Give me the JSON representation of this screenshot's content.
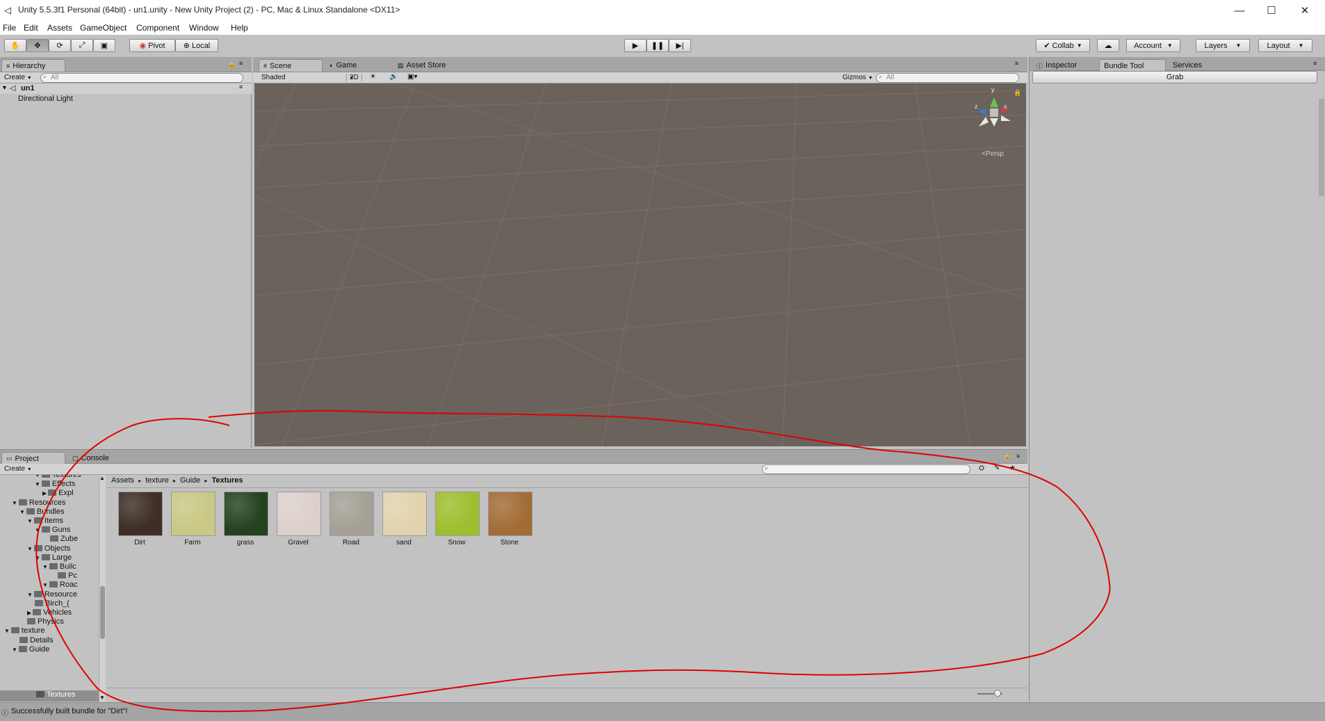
{
  "window": {
    "title": "Unity 5.5.3f1 Personal (64bit) - un1.unity - New Unity Project (2) - PC, Mac & Linux Standalone <DX11>",
    "controls": [
      "—",
      "☐",
      "✕"
    ]
  },
  "menu": [
    "File",
    "Edit",
    "Assets",
    "GameObject",
    "Component",
    "Window",
    "Help"
  ],
  "toolbar": {
    "pivot_label": "Pivot",
    "local_label": "Local",
    "collab_label": "Collab",
    "account_label": "Account",
    "layers_label": "Layers",
    "layout_label": "Layout"
  },
  "hierarchy": {
    "tab": "Hierarchy",
    "create_label": "Create",
    "search_placeholder": "All",
    "scene_name": "un1",
    "items": [
      "Directional Light"
    ]
  },
  "scene": {
    "tabs": [
      "Scene",
      "Game",
      "Asset Store"
    ],
    "shading": "Shaded",
    "mode_2d": "2D",
    "gizmos_label": "Gizmos",
    "search_placeholder": "All",
    "persp_label": "Persp",
    "axis_labels": {
      "y": "y",
      "z": "z",
      "x": "x"
    }
  },
  "inspector": {
    "tabs": [
      "Inspector",
      "Bundle Tool",
      "Services"
    ],
    "grab_label": "Grab"
  },
  "project": {
    "tabs": [
      "Project",
      "Console"
    ],
    "create_label": "Create",
    "breadcrumb": [
      "Assets",
      "texture",
      "Guide",
      "Textures"
    ],
    "tree": [
      {
        "label": "Textures",
        "depth": 4
      },
      {
        "label": "Effects",
        "depth": 4
      },
      {
        "label": "Expl",
        "depth": 5
      },
      {
        "label": "Resources",
        "depth": 1
      },
      {
        "label": "Bundles",
        "depth": 2
      },
      {
        "label": "Items",
        "depth": 3
      },
      {
        "label": "Guns",
        "depth": 4
      },
      {
        "label": "Zube",
        "depth": 6
      },
      {
        "label": "Objects",
        "depth": 3
      },
      {
        "label": "Large",
        "depth": 4
      },
      {
        "label": "Builc",
        "depth": 5
      },
      {
        "label": "Pc",
        "depth": 7
      },
      {
        "label": "Roac",
        "depth": 5
      },
      {
        "label": "Resource",
        "depth": 3
      },
      {
        "label": "Birch_(",
        "depth": 4
      },
      {
        "label": "Vehicles",
        "depth": 3
      },
      {
        "label": "Physics",
        "depth": 3
      },
      {
        "label": "texture",
        "depth": 0
      },
      {
        "label": "Details",
        "depth": 2
      },
      {
        "label": "Guide",
        "depth": 1
      },
      {
        "label": "Textures",
        "depth": 2
      }
    ],
    "assets": [
      {
        "name": "Dirt",
        "color": "#3d2e26"
      },
      {
        "name": "Farm",
        "color": "#c9c885"
      },
      {
        "name": "grass",
        "color": "#24421f"
      },
      {
        "name": "Gravel",
        "color": "#dcd0cc"
      },
      {
        "name": "Road",
        "color": "#a5a095"
      },
      {
        "name": "sand",
        "color": "#e2d3ae"
      },
      {
        "name": "Snow",
        "color": "#9ebe2f"
      },
      {
        "name": "Stone",
        "color": "#a26c37"
      }
    ]
  },
  "status": {
    "message": "Successfully built bundle for \"Dirt\"!"
  },
  "colors": {
    "scene_bg": "#6b625c",
    "panel_bg": "#c2c2c2",
    "annotation": "#e00000"
  }
}
